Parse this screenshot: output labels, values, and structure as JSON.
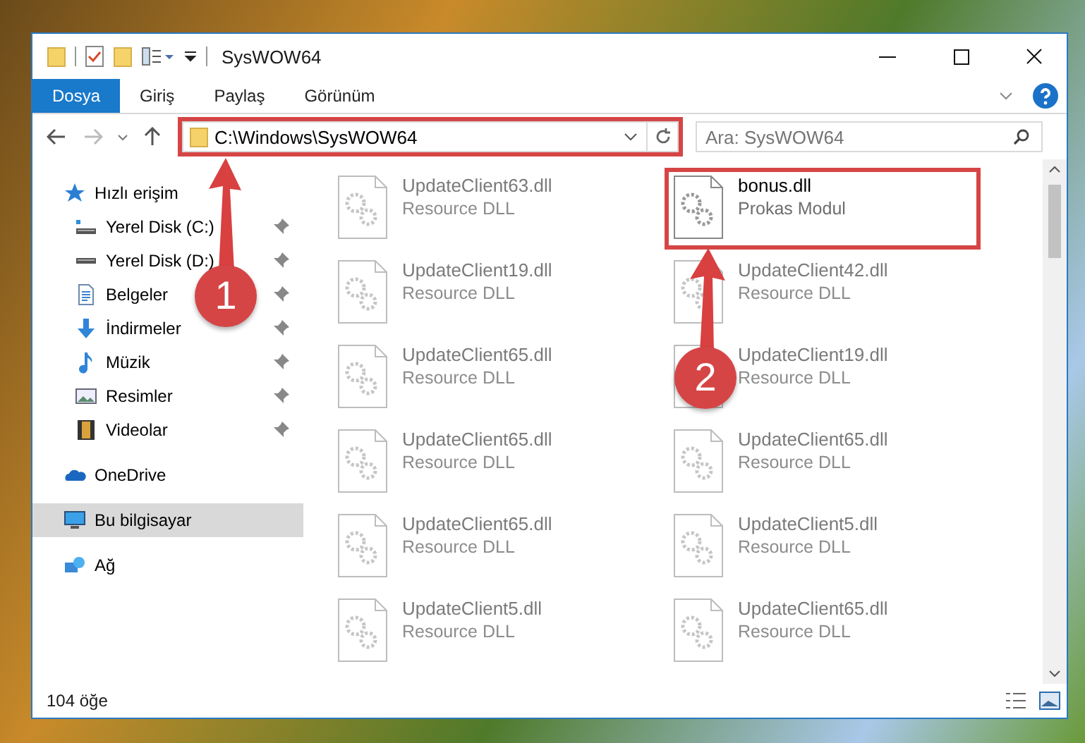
{
  "window": {
    "title": "SysWOW64"
  },
  "ribbon_tabs": [
    {
      "label": "Dosya",
      "selected": true
    },
    {
      "label": "Giriş",
      "selected": false
    },
    {
      "label": "Paylaş",
      "selected": false
    },
    {
      "label": "Görünüm",
      "selected": false
    }
  ],
  "address_bar": {
    "path": "C:\\Windows\\SysWOW64",
    "highlighted": true
  },
  "search": {
    "placeholder": "Ara: SysWOW64"
  },
  "navigation": [
    {
      "label": "Hızlı erişim",
      "kind": "star",
      "selected": false,
      "children": [
        {
          "label": "Yerel Disk (C:)",
          "kind": "drive-c",
          "pinned": true,
          "selected": false
        },
        {
          "label": "Yerel Disk (D:)",
          "kind": "drive",
          "pinned": true,
          "selected": false
        },
        {
          "label": "Belgeler",
          "kind": "document",
          "pinned": true,
          "selected": false
        },
        {
          "label": "İndirmeler",
          "kind": "download",
          "pinned": true,
          "selected": false
        },
        {
          "label": "Müzik",
          "kind": "music",
          "pinned": true,
          "selected": false
        },
        {
          "label": "Resimler",
          "kind": "pictures",
          "pinned": true,
          "selected": false
        },
        {
          "label": "Videolar",
          "kind": "videos",
          "pinned": true,
          "selected": false
        }
      ]
    },
    {
      "label": "OneDrive",
      "kind": "cloud",
      "selected": false
    },
    {
      "label": "Bu bilgisayar",
      "kind": "computer",
      "selected": true
    },
    {
      "label": "Ağ",
      "kind": "network",
      "selected": false
    }
  ],
  "files": [
    {
      "name": "UpdateClient63.dll",
      "type": "Resource DLL",
      "blurred": true,
      "highlighted": false
    },
    {
      "name": "bonus.dll",
      "type": "Prokas Modul",
      "blurred": false,
      "highlighted": true
    },
    {
      "name": "UpdateClient19.dll",
      "type": "Resource DLL",
      "blurred": true,
      "highlighted": false
    },
    {
      "name": "UpdateClient42.dll",
      "type": "Resource DLL",
      "blurred": true,
      "highlighted": false
    },
    {
      "name": "UpdateClient65.dll",
      "type": "Resource DLL",
      "blurred": true,
      "highlighted": false
    },
    {
      "name": "UpdateClient19.dll",
      "type": "Resource DLL",
      "blurred": true,
      "highlighted": false
    },
    {
      "name": "UpdateClient65.dll",
      "type": "Resource DLL",
      "blurred": true,
      "highlighted": false
    },
    {
      "name": "UpdateClient65.dll",
      "type": "Resource DLL",
      "blurred": true,
      "highlighted": false
    },
    {
      "name": "UpdateClient65.dll",
      "type": "Resource DLL",
      "blurred": true,
      "highlighted": false
    },
    {
      "name": "UpdateClient5.dll",
      "type": "Resource DLL",
      "blurred": true,
      "highlighted": false
    },
    {
      "name": "UpdateClient5.dll",
      "type": "Resource DLL",
      "blurred": true,
      "highlighted": false
    },
    {
      "name": "UpdateClient65.dll",
      "type": "Resource DLL",
      "blurred": true,
      "highlighted": false
    }
  ],
  "annotations": [
    {
      "label": "1"
    },
    {
      "label": "2"
    }
  ],
  "status_bar": {
    "count": "104 öğe"
  }
}
